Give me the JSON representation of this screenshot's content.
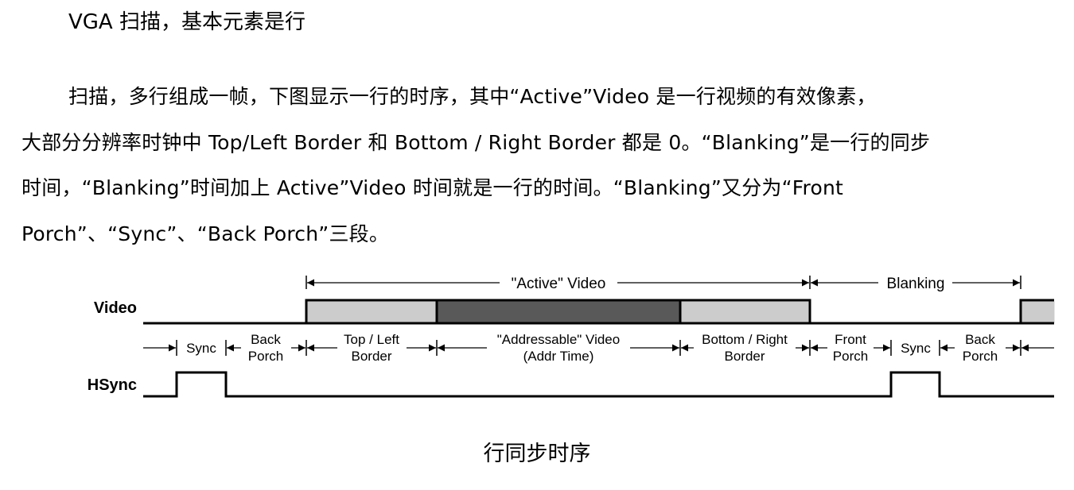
{
  "heading": "VGA 扫描，基本元素是行",
  "paragraph": {
    "lines": [
      "扫描，多行组成一帧，下图显示一行的时序，其中“Active”Video 是一行视频的有效像素，",
      "大部分分辨率时钟中 Top/Left Border 和 Bottom / Right Border 都是 0。“Blanking”是一行的同步",
      "时间，“Blanking”时间加上 Active”Video 时间就是一行的时间。“Blanking”又分为“Front",
      "Porch”、“Sync”、“Back Porch”三段。"
    ]
  },
  "diagram": {
    "top_labels": {
      "active_video": "\"Active\" Video",
      "blanking": "Blanking"
    },
    "signal_labels": {
      "video": "Video",
      "hsync": "HSync"
    },
    "segments": {
      "sync_1": "Sync",
      "back_porch_1_line1": "Back",
      "back_porch_1_line2": "Porch",
      "top_left_line1": "Top / Left",
      "top_left_line2": "Border",
      "addressable_line1": "\"Addressable\" Video",
      "addressable_line2": "(Addr Time)",
      "bottom_right_line1": "Bottom / Right",
      "bottom_right_line2": "Border",
      "front_porch_line1": "Front",
      "front_porch_line2": "Porch",
      "sync_2": "Sync",
      "back_porch_2_line1": "Back",
      "back_porch_2_line2": "Porch"
    },
    "colors": {
      "border_fill": "#cccccc",
      "addressable_fill": "#595959",
      "line": "#000000"
    }
  },
  "caption": "行同步时序"
}
